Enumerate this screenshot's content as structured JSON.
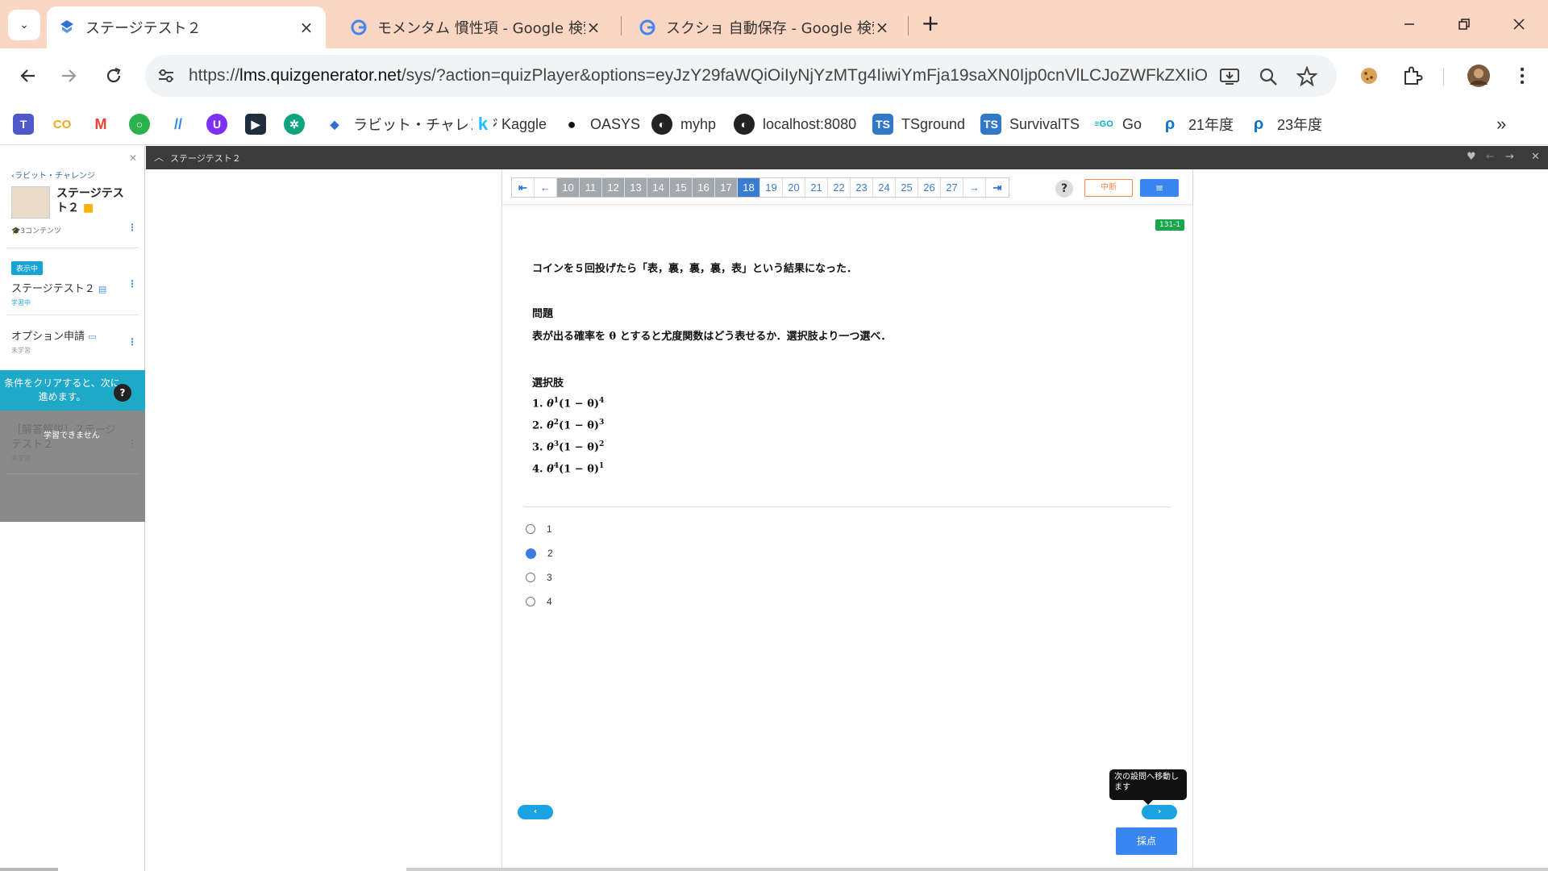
{
  "browser": {
    "tabs": [
      {
        "title": "ステージテスト２",
        "active": true
      },
      {
        "title": "モメンタム 慣性項 - Google 検索",
        "active": false
      },
      {
        "title": "スクショ 自動保存 - Google 検索",
        "active": false
      }
    ],
    "url_prefix": "https://",
    "url_host": "lms.quizgenerator.net",
    "url_rest": "/sys/?action=quizPlayer&options=eyJzY29faWQiOiIyNjYzMTg4IiwiYmFja19saXN0Ijp0cnVlLCJoZWFkZXIiOn...",
    "bookmarks": [
      {
        "label": "ラビット・チャレンジ",
        "icon": "rabbit-icon"
      },
      {
        "label": "Kaggle",
        "icon": "kaggle-icon"
      },
      {
        "label": "OASYS",
        "icon": "oasys-icon"
      },
      {
        "label": "myhp",
        "icon": "globe-icon"
      },
      {
        "label": "localhost:8080",
        "icon": "globe-icon"
      },
      {
        "label": "TSground",
        "icon": "ts-icon"
      },
      {
        "label": "SurvivalTS",
        "icon": "ts-icon"
      },
      {
        "label": "Go",
        "icon": "go-icon"
      },
      {
        "label": "21年度",
        "icon": "edge-icon"
      },
      {
        "label": "23年度",
        "icon": "edge-icon"
      }
    ]
  },
  "sidebar": {
    "back_label": "ラビット・チャレンジ",
    "course_title": "ステージテスト２",
    "content_count": "3コンテンツ",
    "showing_badge": "表示中",
    "items": [
      {
        "title": "ステージテスト２",
        "status": "学習中"
      },
      {
        "title": "オプション申請",
        "status": "未学習"
      }
    ],
    "notice": "条件をクリアすると、次に進めます。",
    "help": "?",
    "locked_item": {
      "title": "［解答解説］ステージテスト２",
      "status": "未学習",
      "message": "学習できません"
    }
  },
  "player": {
    "title": "ステージテスト２",
    "pages": [
      "10",
      "11",
      "12",
      "13",
      "14",
      "15",
      "16",
      "17",
      "18",
      "19",
      "20",
      "21",
      "22",
      "23",
      "24",
      "25",
      "26",
      "27"
    ],
    "current_page": "18",
    "pause_label": "中断",
    "list_label": "≡",
    "help": "?",
    "question_id": "131-1"
  },
  "question": {
    "intro": "コインを５回投げたら「表，裏，裏，裏，表」という結果になった．",
    "heading": "問題",
    "body": "表が出る確率を θ とすると尤度関数はどう表せるか．選択肢より一つ選べ．",
    "choices_heading": "選択肢",
    "choices": [
      {
        "num": "1.",
        "a": "1",
        "b": "4"
      },
      {
        "num": "2.",
        "a": "2",
        "b": "3"
      },
      {
        "num": "3.",
        "a": "3",
        "b": "2"
      },
      {
        "num": "4.",
        "a": "4",
        "b": "1"
      }
    ],
    "answers": [
      "1",
      "2",
      "3",
      "4"
    ],
    "selected": "2"
  },
  "footer": {
    "tooltip": "次の設問へ移動します",
    "prev": "‹",
    "next": "›",
    "grade": "採点"
  },
  "colors": {
    "tabstrip": "#fbd6c2",
    "accent": "#3a86f0",
    "notice": "#1fa9c8",
    "pause": "#f08a4b",
    "qid": "#1aa64a"
  }
}
